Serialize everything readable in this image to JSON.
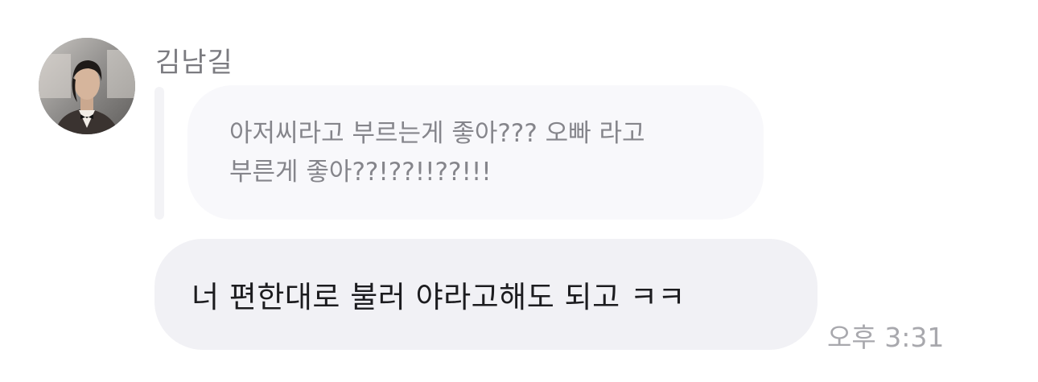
{
  "sender": {
    "name": "김남길",
    "avatar_icon": "profile-photo"
  },
  "reply": {
    "quoted_text": "아저씨라고 부르는게 좋아??? 오빠 라고\n부른게 좋아??!??!!??!!!"
  },
  "message": {
    "text": "너 편한대로 불러 야라고해도 되고 ㅋㅋ",
    "time": "오후 3:31"
  },
  "colors": {
    "background": "#ffffff",
    "quote_bubble": "#f8f8fb",
    "message_bubble": "#f1f1f5",
    "name_text": "#7b7b80",
    "quote_text": "#85858b",
    "message_text": "#1c1c1f",
    "time_text": "#a8a8ad"
  }
}
